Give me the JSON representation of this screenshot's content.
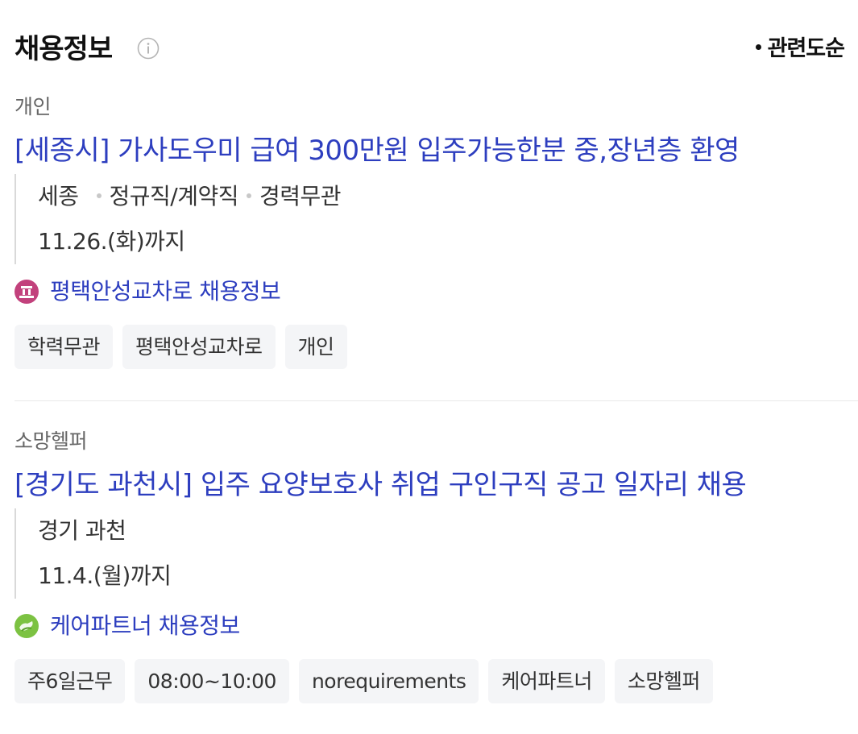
{
  "header": {
    "title": "채용정보",
    "sort_label": "관련도순"
  },
  "jobs": [
    {
      "source": "개인",
      "title": "[세종시] 가사도우미 급여 300만원 입주가능한분 중,장년층 환영",
      "location": "세종",
      "employment_type": "정규직/계약직",
      "experience": "경력무관",
      "deadline": "11.26.(화)까지",
      "company": "평택안성교차로 채용정보",
      "tags": [
        "학력무관",
        "평택안성교차로",
        "개인"
      ]
    },
    {
      "source": "소망헬퍼",
      "title": "[경기도 과천시] 입주 요양보호사 취업 구인구직 공고 일자리 채용",
      "location": "경기 과천",
      "deadline": "11.4.(월)까지",
      "company": "케어파트너 채용정보",
      "tags": [
        "주6일근무",
        "08:00~10:00",
        "norequirements",
        "케어파트너",
        "소망헬퍼"
      ]
    }
  ],
  "colors": {
    "link": "#2d3ebf",
    "logo1": "#c2417c",
    "logo2": "#7cc242"
  }
}
